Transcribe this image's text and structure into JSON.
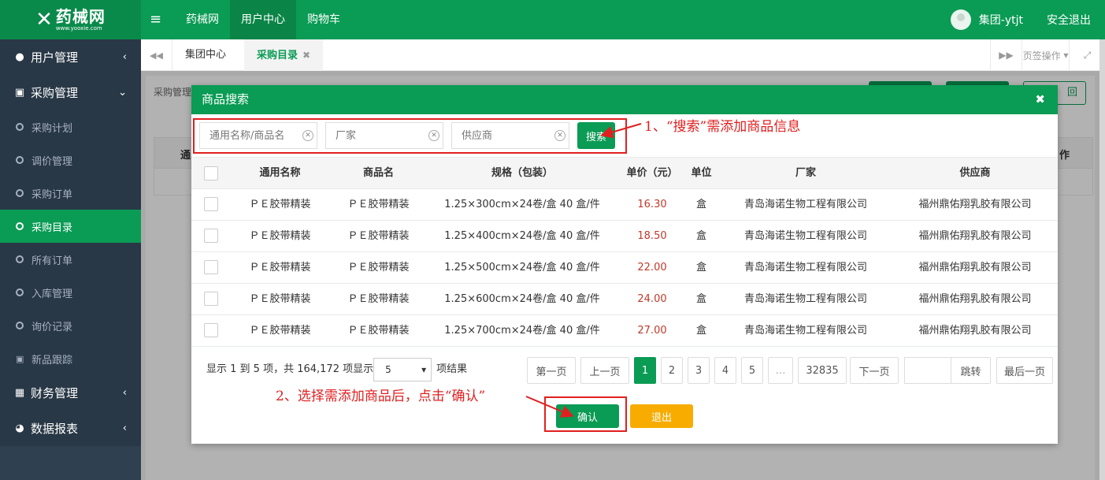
{
  "header": {
    "logo_name": "药械网",
    "logo_url": "www.yooxie.com",
    "logo_mark": "✕",
    "nav": [
      "药械网",
      "用户中心",
      "购物车"
    ],
    "username": "集团-ytjt",
    "logout": "安全退出",
    "brand_color": "#0a9b54"
  },
  "sidebar": {
    "group_user": "用户管理",
    "group_purchase": "采购管理",
    "items": [
      "采购计划",
      "调价管理",
      "采购订单",
      "采购目录",
      "所有订单",
      "入库管理",
      "询价记录",
      "新品跟踪"
    ],
    "group_finance": "财务管理",
    "group_report": "数据报表"
  },
  "tabs": {
    "home": "集团中心",
    "active": "采购目录",
    "tab_ops": "页签操作"
  },
  "background": {
    "crumb": "采购管理",
    "header_left": "通",
    "header_right": "作",
    "btn_return": "回"
  },
  "modal": {
    "title": "商品搜索",
    "search": {
      "name_placeholder": "通用名称/商品名",
      "maker_placeholder": "厂家",
      "supplier_placeholder": "供应商",
      "button": "搜索"
    },
    "columns": [
      "通用名称",
      "商品名",
      "规格（包装）",
      "单价（元）",
      "单位",
      "厂家",
      "供应商"
    ],
    "rows": [
      {
        "generic": "ＰＥ胶带精装",
        "product": "ＰＥ胶带精装",
        "spec": "1.25×300cm×24卷/盒 40 盒/件",
        "price": "16.30",
        "unit": "盒",
        "maker": "青岛海诺生物工程有限公司",
        "supplier": "福州鼎佑翔乳胶有限公司"
      },
      {
        "generic": "ＰＥ胶带精装",
        "product": "ＰＥ胶带精装",
        "spec": "1.25×400cm×24卷/盒 40 盒/件",
        "price": "18.50",
        "unit": "盒",
        "maker": "青岛海诺生物工程有限公司",
        "supplier": "福州鼎佑翔乳胶有限公司"
      },
      {
        "generic": "ＰＥ胶带精装",
        "product": "ＰＥ胶带精装",
        "spec": "1.25×500cm×24卷/盒 40 盒/件",
        "price": "22.00",
        "unit": "盒",
        "maker": "青岛海诺生物工程有限公司",
        "supplier": "福州鼎佑翔乳胶有限公司"
      },
      {
        "generic": "ＰＥ胶带精装",
        "product": "ＰＥ胶带精装",
        "spec": "1.25×600cm×24卷/盒 40 盒/件",
        "price": "24.00",
        "unit": "盒",
        "maker": "青岛海诺生物工程有限公司",
        "supplier": "福州鼎佑翔乳胶有限公司"
      },
      {
        "generic": "ＰＥ胶带精装",
        "product": "ＰＥ胶带精装",
        "spec": "1.25×700cm×24卷/盒 40 盒/件",
        "price": "27.00",
        "unit": "盒",
        "maker": "青岛海诺生物工程有限公司",
        "supplier": "福州鼎佑翔乳胶有限公司"
      }
    ],
    "pager": {
      "info": "显示 1 到 5 项，共 164,172 项显示",
      "page_size": "5",
      "suffix": "项结果",
      "first": "第一页",
      "prev": "上一页",
      "pages": [
        "1",
        "2",
        "3",
        "4",
        "5",
        "…",
        "32835"
      ],
      "next": "下一页",
      "jump": "跳转",
      "last": "最后一页"
    },
    "confirm": "确认",
    "exit": "退出"
  },
  "annotations": {
    "note1": "1、“搜索”需添加商品信息",
    "note2": "2、选择需添加商品后，点击“确认”"
  }
}
